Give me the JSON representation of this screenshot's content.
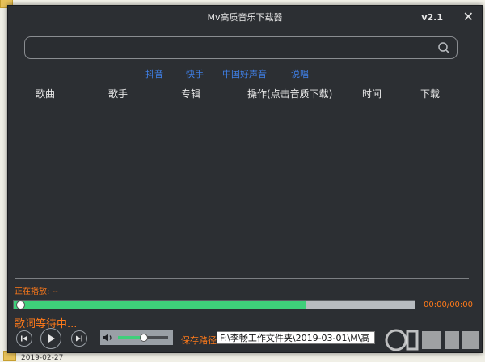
{
  "app": {
    "title": "Mv高质音乐下载器",
    "version": "v2.1",
    "close_glyph": "✕"
  },
  "search": {
    "value": "",
    "placeholder": "",
    "icon": "search-icon"
  },
  "tabs": [
    {
      "label": "抖音"
    },
    {
      "label": "快手"
    },
    {
      "label": "中国好声音"
    },
    {
      "label": "说唱"
    }
  ],
  "table": {
    "columns": [
      "歌曲",
      "歌手",
      "专辑",
      "操作(点击音质下载)",
      "时间",
      "下载"
    ],
    "rows": []
  },
  "player": {
    "now_playing": "正在播放: --",
    "progress_fraction": 0.73,
    "time": "00:00/00:00",
    "lyrics": "歌词等待中...",
    "volume_fraction": 0.5,
    "controls": [
      "prev-icon",
      "play-icon",
      "next-icon"
    ]
  },
  "save": {
    "label": "保存路径",
    "path": "F:\\李畅工作文件夹\\2019-03-01\\M\\高"
  },
  "desktop": {
    "bottom_text": "2019-02-27"
  },
  "colors": {
    "window_bg": "#2c2f33",
    "accent_orange": "#ff7a1a",
    "tab_blue": "#3f7fe6",
    "progress_green": "#3ed07a"
  }
}
